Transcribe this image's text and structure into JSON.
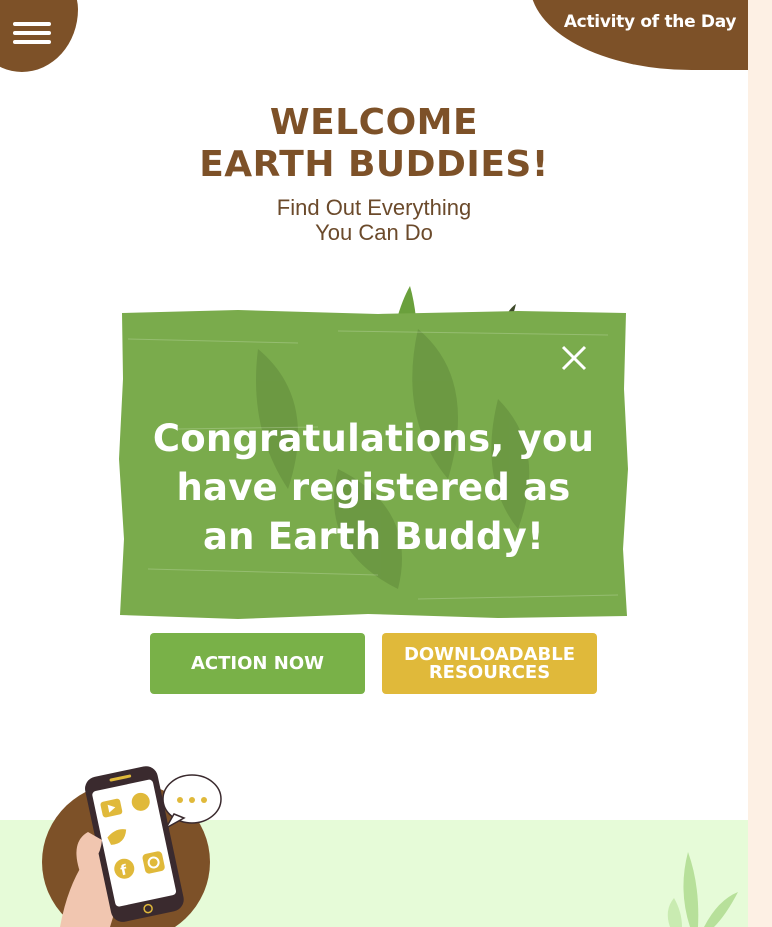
{
  "header": {
    "menu_icon": "hamburger-menu-icon",
    "activity_link": "Activity of the Day"
  },
  "hero": {
    "title_line1": "WELCOME",
    "title_line2": "EARTH BUDDIES!",
    "subtitle_line1": "Find Out Everything",
    "subtitle_line2": "You Can Do"
  },
  "modal": {
    "message_line1": "Congratulations, you",
    "message_line2": "have registered as",
    "message_line3": "an Earth Buddy!",
    "close_icon": "close-icon"
  },
  "buttons": {
    "action_now": "ACTION NOW",
    "resources_line1": "DOWNLOADABLE",
    "resources_line2": "RESOURCES"
  },
  "colors": {
    "brown": "#7d5128",
    "modal_green": "#7aab4c",
    "action_green": "#79b148",
    "resources_yellow": "#e0b93a",
    "footer_green": "#e6fbd8"
  },
  "illustrations": {
    "phone": "phone-with-social-apps-icon",
    "plant": "plant-icon"
  }
}
